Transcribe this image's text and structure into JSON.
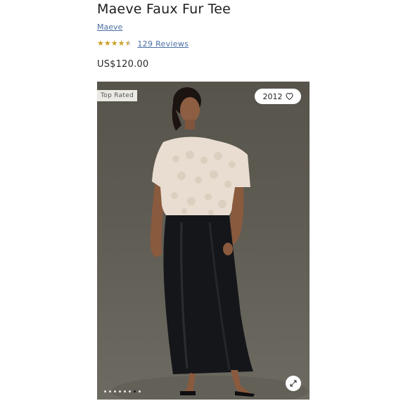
{
  "product": {
    "title": "Maeve Faux Fur Tee",
    "brand": "Maeve",
    "rating": 4.5,
    "reviews_label": "129 Reviews",
    "price": "US$120.00"
  },
  "gallery": {
    "badge": "Top Rated",
    "wishlist_count": "2012",
    "total_images": 8,
    "active_index": 6,
    "colors": {
      "star": "#c9a227",
      "link": "#4a6fa5",
      "photo_bg": "#5e5b53"
    }
  }
}
